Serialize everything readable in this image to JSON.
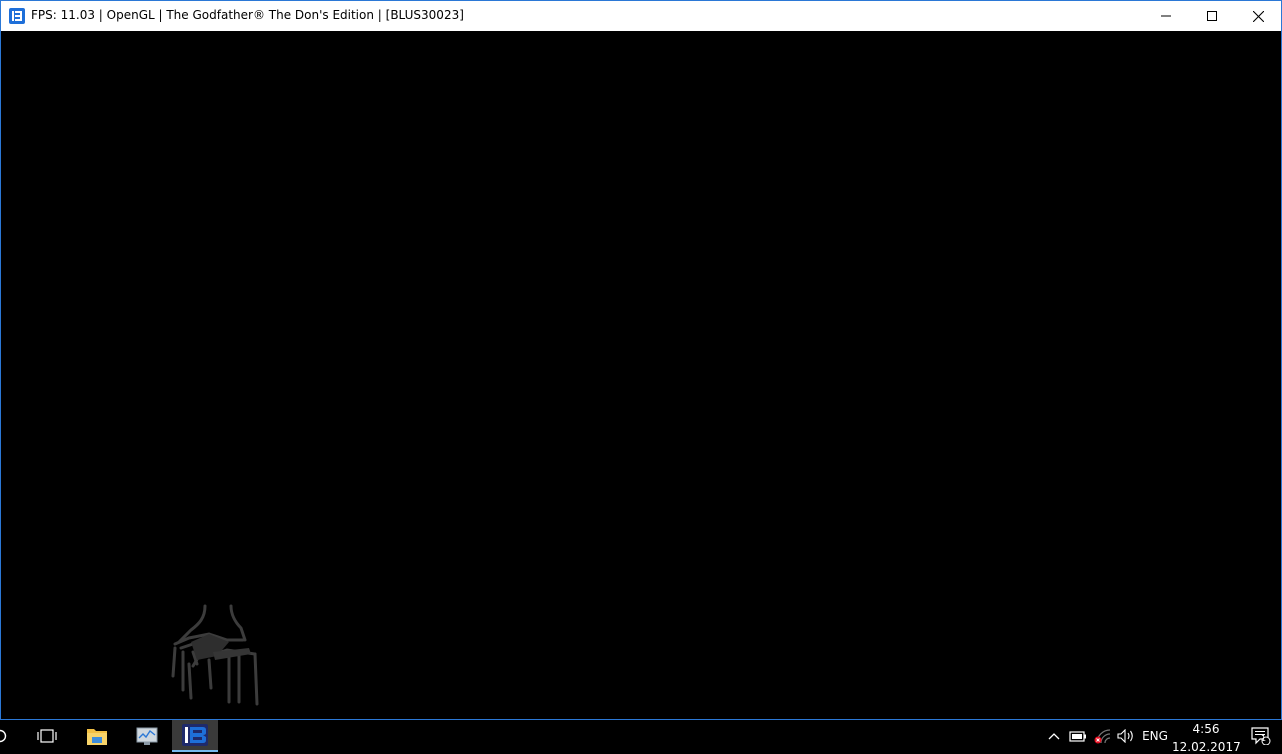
{
  "window": {
    "title": "FPS: 11.03 | OpenGL | The Godfather® The Don's Edition | [BLUS30023]",
    "app_icon": "rpcs3-icon",
    "controls": {
      "minimize_icon": "minimize-icon",
      "maximize_icon": "maximize-icon",
      "close_icon": "close-icon"
    }
  },
  "taskbar": {
    "apps": [
      {
        "name": "task-view-icon"
      },
      {
        "name": "file-explorer-icon"
      },
      {
        "name": "resource-monitor-icon"
      },
      {
        "name": "rpcs3-taskbar-icon",
        "active": true
      }
    ],
    "tray": {
      "language": "ENG",
      "time": "4:56",
      "date": "12.02.2017",
      "notification_count": "1"
    }
  },
  "colors": {
    "window_border": "#2b78d6",
    "accent": "#1e6fd9",
    "active_underline": "#76b9ed"
  }
}
